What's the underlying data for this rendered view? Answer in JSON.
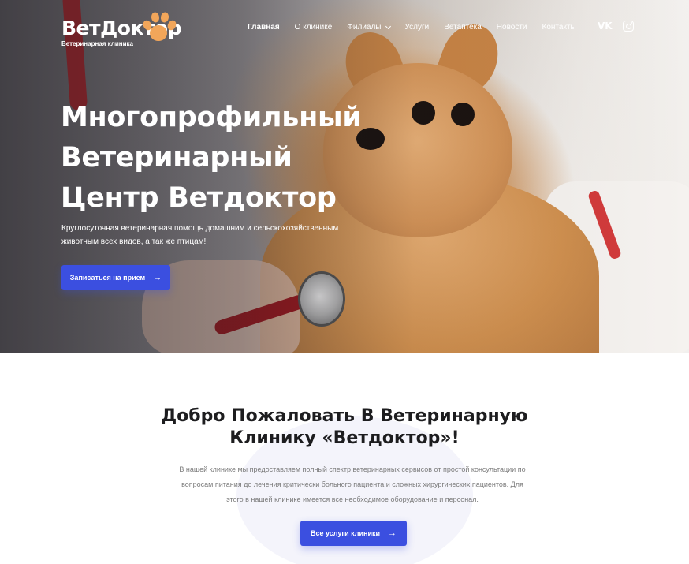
{
  "logo": {
    "title": "ВетДоктор",
    "subtitle": "Ветеринарная клиника"
  },
  "nav": {
    "items": [
      {
        "label": "Главная",
        "active": true
      },
      {
        "label": "О клинике"
      },
      {
        "label": "Филиалы",
        "dropdown": true
      },
      {
        "label": "Услуги"
      },
      {
        "label": "Ветаптека"
      },
      {
        "label": "Новости"
      },
      {
        "label": "Контакты"
      }
    ],
    "social": [
      {
        "label": "VK",
        "icon": "vk-icon"
      },
      {
        "icon": "instagram-icon"
      }
    ]
  },
  "hero": {
    "title_lines": [
      "Многопрофильный",
      "Ветеринарный",
      "Центр Ветдоктор"
    ],
    "description": "Круглосуточная ветеринарная помощь домашним и сельскохозяйственным животным всех видов, а так же птицам!",
    "cta_label": "Записаться на прием",
    "cta_icon": "arrow-right-icon"
  },
  "welcome": {
    "title_lines": [
      "Добро Пожаловать В Ветеринарную",
      "Клинику «Ветдоктор»!"
    ],
    "text_lines": [
      "В нашей клинике мы предоставляем полный спектр ветеринарных сервисов от простой консультации по",
      "вопросам питания  до лечения критически больного пациента и сложных хирургических пациентов. Для",
      "этого в нашей клинике имеется все необходимое оборудование и персонал."
    ],
    "cta_label": "Все услуги клиники",
    "cta_icon": "arrow-right-icon"
  },
  "colors": {
    "accent": "#3b4fe0",
    "paw": "#f2a65a",
    "text_dark": "#1d1d1f",
    "text_muted": "#7b7b7b"
  }
}
